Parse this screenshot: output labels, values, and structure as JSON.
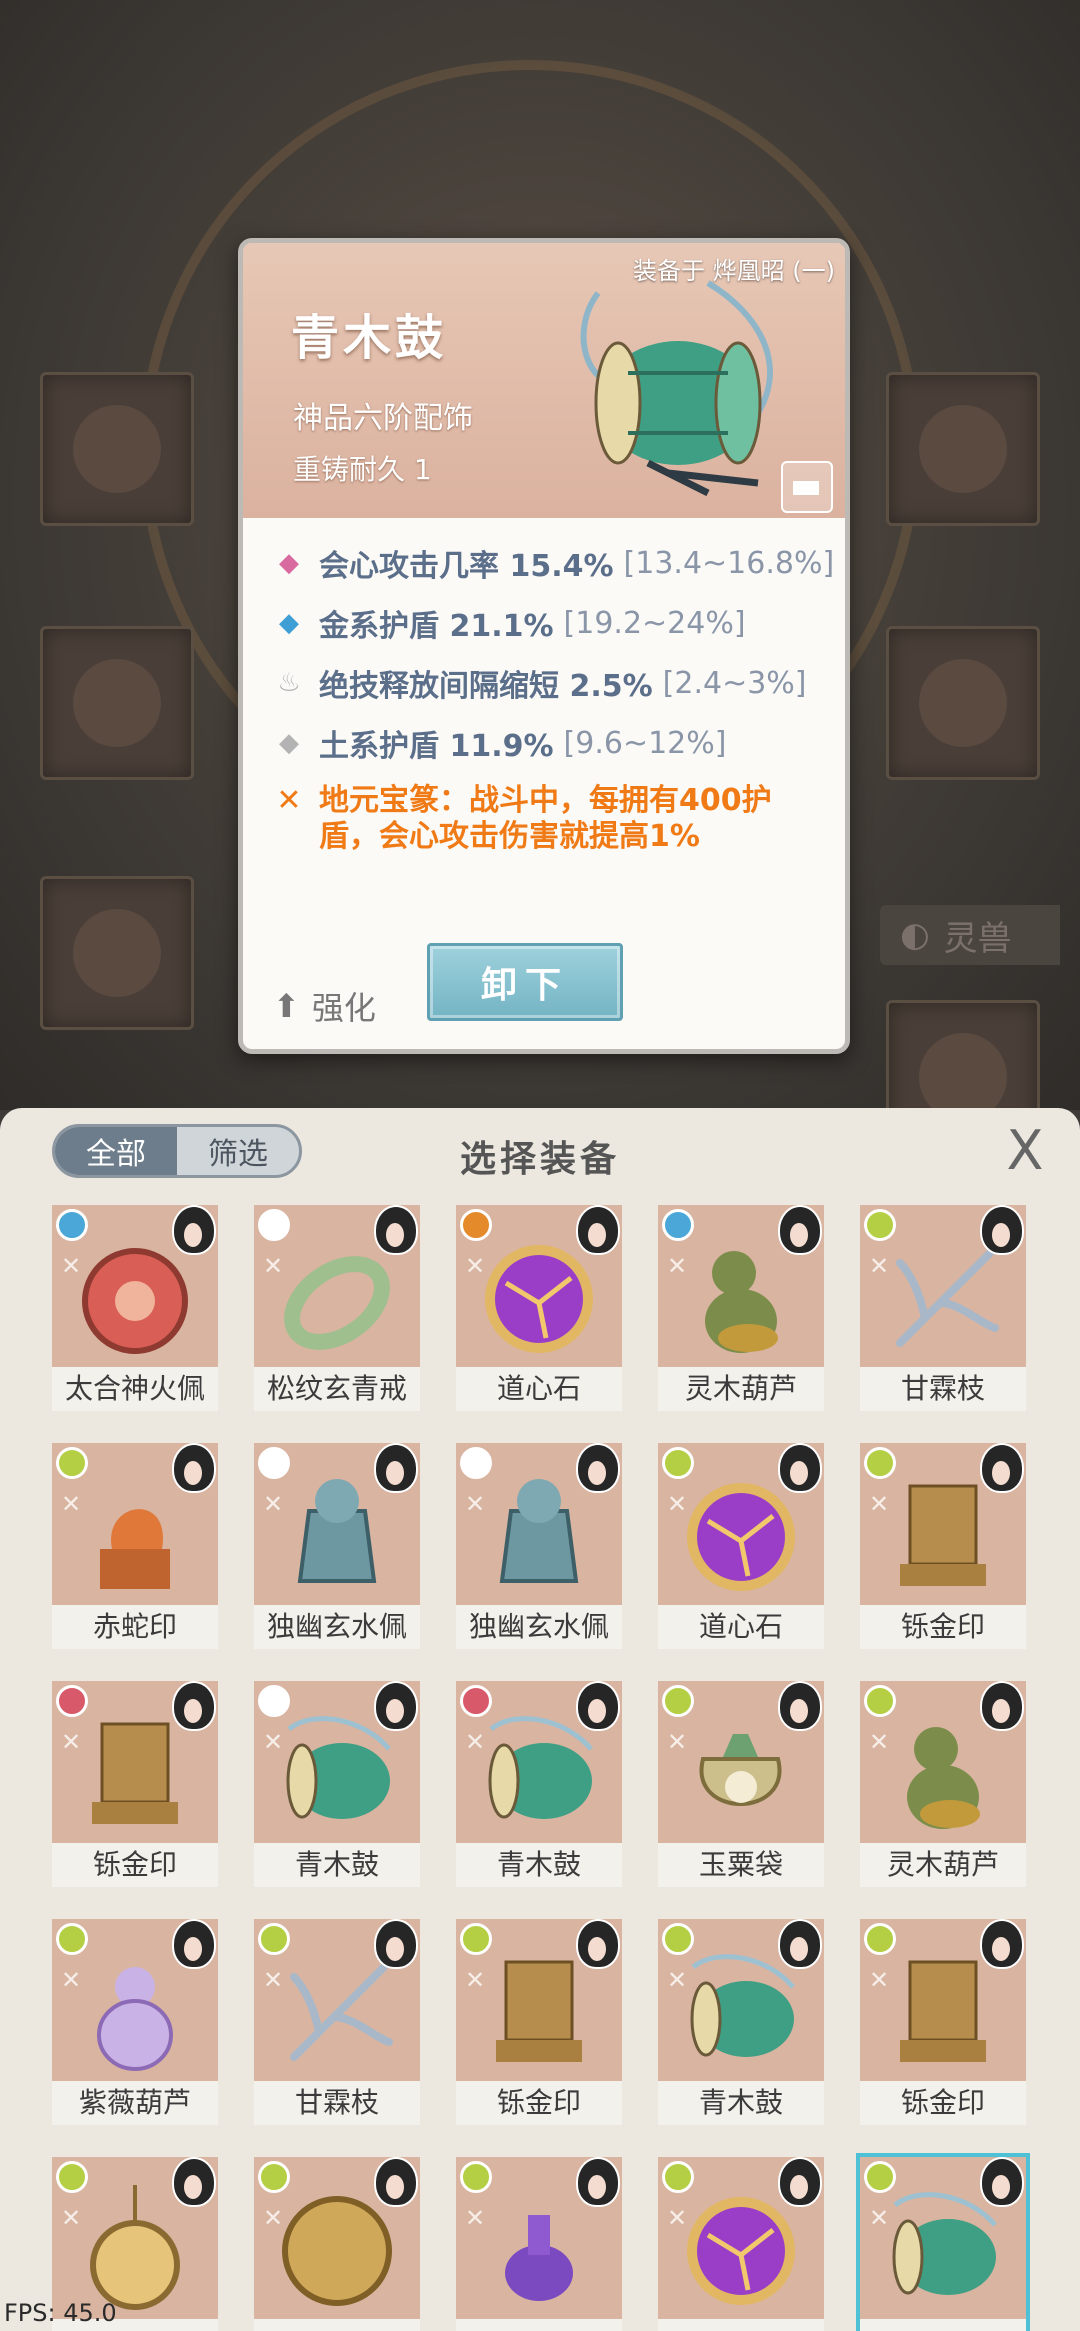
{
  "background": {
    "side_tab_label": "灵兽"
  },
  "detail": {
    "equipped_label": "装备于 烨凰昭 (一)",
    "name": "青木鼓",
    "grade": "神品六阶配饰",
    "durability": "重铸耐久 1",
    "stats": [
      {
        "icon": "pink-diamond-icon",
        "color": "#d86aa0",
        "text": "会心攻击几率 15.4%",
        "range": "[13.4~16.8%]"
      },
      {
        "icon": "blue-diamond-icon",
        "color": "#3f9fd4",
        "text": "金系护盾 21.1%",
        "range": "[19.2~24%]"
      },
      {
        "icon": "flame-icon",
        "color": "#b3b3b3",
        "text": "绝技释放间隔缩短 2.5%",
        "range": "[2.4~3%]"
      },
      {
        "icon": "grey-diamond-icon",
        "color": "#b3b3b3",
        "text": "土系护盾 11.9%",
        "range": "[9.6~12%]"
      }
    ],
    "special": "地元宝篆：战斗中，每拥有400护盾，会心攻击伤害就提高1%",
    "strengthen_label": "强化",
    "unequip_label": "卸下"
  },
  "panel": {
    "tabs": [
      "全部",
      "筛选"
    ],
    "active_tab": "全部",
    "title": "选择装备",
    "close_glyph": "X",
    "items": [
      {
        "name": "太合神火佩",
        "elem": "#4aa7d8",
        "art": "amulet-red"
      },
      {
        "name": "松纹玄青戒",
        "elem": "#ffffff",
        "art": "ring-green"
      },
      {
        "name": "道心石",
        "elem": "#e48a2a",
        "art": "orb-purple"
      },
      {
        "name": "灵木葫芦",
        "elem": "#4aa7d8",
        "art": "gourd-green"
      },
      {
        "name": "甘霖枝",
        "elem": "#b5cf45",
        "art": "branch"
      },
      {
        "name": "赤蛇印",
        "elem": "#b5cf45",
        "art": "seal-red"
      },
      {
        "name": "独幽玄水佩",
        "elem": "#ffffff",
        "art": "vase-blue"
      },
      {
        "name": "独幽玄水佩",
        "elem": "#ffffff",
        "art": "vase-blue"
      },
      {
        "name": "道心石",
        "elem": "#b5cf45",
        "art": "orb-purple"
      },
      {
        "name": "铄金印",
        "elem": "#b5cf45",
        "art": "seal-gold"
      },
      {
        "name": "铄金印",
        "elem": "#d85a6a",
        "art": "seal-gold"
      },
      {
        "name": "青木鼓",
        "elem": "#ffffff",
        "art": "drum"
      },
      {
        "name": "青木鼓",
        "elem": "#d85a6a",
        "art": "drum"
      },
      {
        "name": "玉粟袋",
        "elem": "#b5cf45",
        "art": "bag"
      },
      {
        "name": "灵木葫芦",
        "elem": "#b5cf45",
        "art": "gourd-green"
      },
      {
        "name": "紫薇葫芦",
        "elem": "#b5cf45",
        "art": "gourd-purple"
      },
      {
        "name": "甘霖枝",
        "elem": "#b5cf45",
        "art": "branch"
      },
      {
        "name": "铄金印",
        "elem": "#b5cf45",
        "art": "seal-gold"
      },
      {
        "name": "青木鼓",
        "elem": "#b5cf45",
        "art": "drum"
      },
      {
        "name": "铄金印",
        "elem": "#b5cf45",
        "art": "seal-gold"
      },
      {
        "name": "",
        "elem": "#b5cf45",
        "art": "amulet-gold"
      },
      {
        "name": "",
        "elem": "#b5cf45",
        "art": "mirror"
      },
      {
        "name": "",
        "elem": "#b5cf45",
        "art": "bottle-purple"
      },
      {
        "name": "",
        "elem": "#b5cf45",
        "art": "orb-purple"
      },
      {
        "name": "",
        "elem": "#b5cf45",
        "art": "drum",
        "selected": true
      }
    ]
  },
  "fps": "FPS: 45.0"
}
